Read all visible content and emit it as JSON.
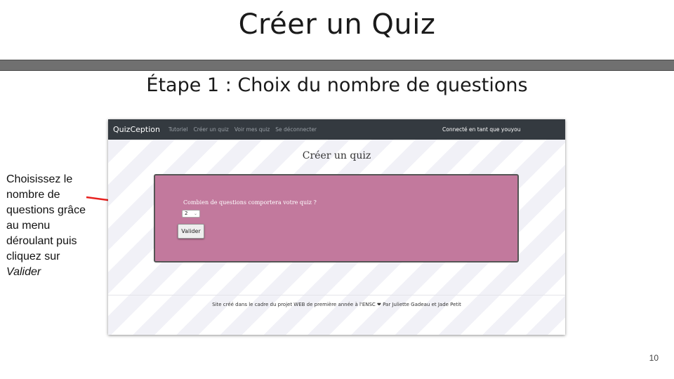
{
  "slide": {
    "title": "Créer un Quiz",
    "subtitle": "Étape 1 : Choix du nombre de questions",
    "annotation_text": "Choisissez le nombre de questions grâce au menu déroulant puis cliquez sur",
    "annotation_emphasis": "Valider",
    "page_number": "10",
    "arrow_color": "#e8201e"
  },
  "app": {
    "brand": "QuizCeption",
    "nav_links": [
      "Tutoriel",
      "Créer un quiz",
      "Voir mes quiz",
      "Se déconnecter"
    ],
    "user_status": "Connecté en tant que youyou",
    "page_heading": "Créer un quiz",
    "form": {
      "question_label": "Combien de questions comportera votre quiz ?",
      "select_value": "2",
      "submit_label": "Valider",
      "box_color": "#c2799d"
    },
    "footer": "Site créé dans le cadre du projet WEB de première année à l'ENSC ❤ Par Juliette Gadeau et Jade Petit"
  }
}
